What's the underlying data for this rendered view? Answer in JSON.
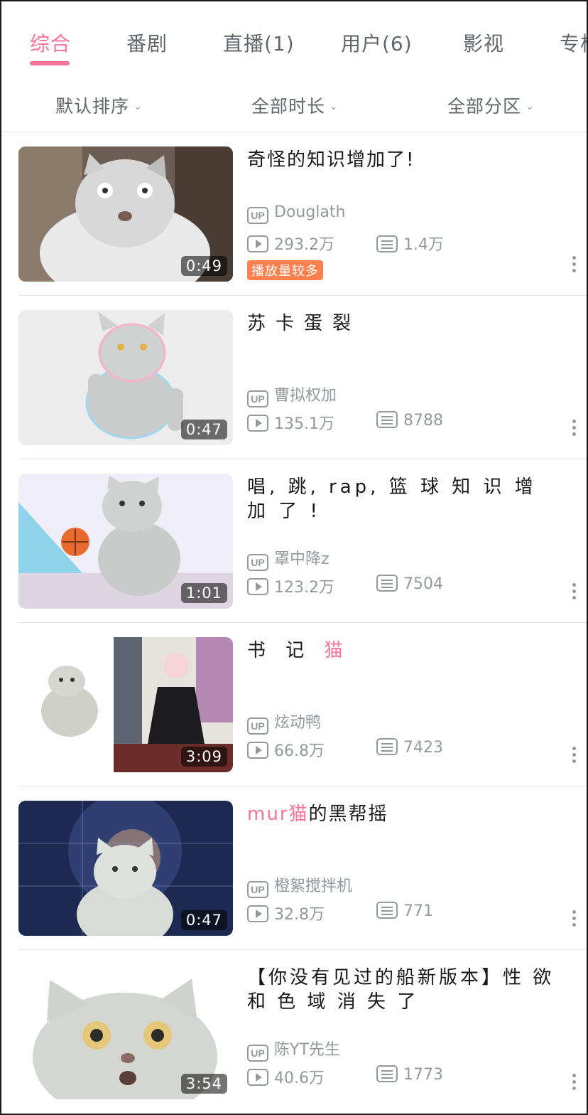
{
  "tabs": [
    {
      "label": "综合"
    },
    {
      "label": "番剧"
    },
    {
      "label": "直播(1)"
    },
    {
      "label": "用户(6)"
    },
    {
      "label": "影视"
    },
    {
      "label": "专栏"
    }
  ],
  "filters": [
    {
      "label": "默认排序"
    },
    {
      "label": "全部时长"
    },
    {
      "label": "全部分区"
    }
  ],
  "colors": {
    "accent": "#fb7299",
    "badge": "#ff7f4f",
    "muted": "#9499a0"
  },
  "videos": [
    {
      "title": "奇怪的知识增加了!",
      "author": "Douglath",
      "views": "293.2万",
      "danmaku": "1.4万",
      "duration": "0:49",
      "badge": "播放量较多"
    },
    {
      "title": "苏卡蛋裂",
      "author": "曹拟权加",
      "views": "135.1万",
      "danmaku": "8788",
      "duration": "0:47"
    },
    {
      "title": "唱, 跳, rap, 篮 球 知 识 增 加 了 !",
      "author": "罩中降z",
      "views": "123.2万",
      "danmaku": "7504",
      "duration": "1:01"
    },
    {
      "title_pre": "书 记 ",
      "title_hl": "猫",
      "author": "炫动鸭",
      "views": "66.8万",
      "danmaku": "7423",
      "duration": "3:09"
    },
    {
      "title_hl": "mur猫",
      "title_post": "的黑帮摇",
      "author": "橙絮搅拌机",
      "views": "32.8万",
      "danmaku": "771",
      "duration": "0:47"
    },
    {
      "title": "【你没有见过的船新版本】性 欲 和 色 域 消 失 了",
      "author": "陈YT先生",
      "views": "40.6万",
      "danmaku": "1773",
      "duration": "3:54"
    }
  ]
}
